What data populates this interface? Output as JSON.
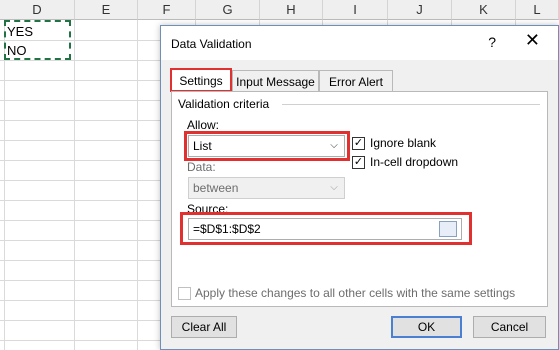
{
  "sheet": {
    "columns": [
      "D",
      "E",
      "F",
      "G",
      "H",
      "I",
      "J",
      "K",
      "L"
    ],
    "cells": [
      {
        "address": "D1",
        "value": "YES"
      },
      {
        "address": "D2",
        "value": "NO"
      }
    ]
  },
  "dialog": {
    "title": "Data Validation",
    "help_label": "?",
    "close_label": "✕",
    "tabs": [
      {
        "label": "Settings",
        "active": true
      },
      {
        "label": "Input Message",
        "active": false
      },
      {
        "label": "Error Alert",
        "active": false
      }
    ],
    "validation_criteria_label": "Validation criteria",
    "allow": {
      "label": "Allow:",
      "value": "List"
    },
    "ignore_blank": {
      "label": "Ignore blank",
      "checked": true
    },
    "in_cell_dropdown": {
      "label": "In-cell dropdown",
      "checked": true
    },
    "data": {
      "label": "Data:",
      "value": "between"
    },
    "source": {
      "label": "Source:",
      "value": "=$D$1:$D$2"
    },
    "apply_all": {
      "label": "Apply these changes to all other cells with the same settings",
      "checked": false
    },
    "buttons": {
      "clear_all": "Clear All",
      "ok": "OK",
      "cancel": "Cancel"
    },
    "colors": {
      "highlight": "#e03030",
      "marquee": "#217346"
    }
  }
}
